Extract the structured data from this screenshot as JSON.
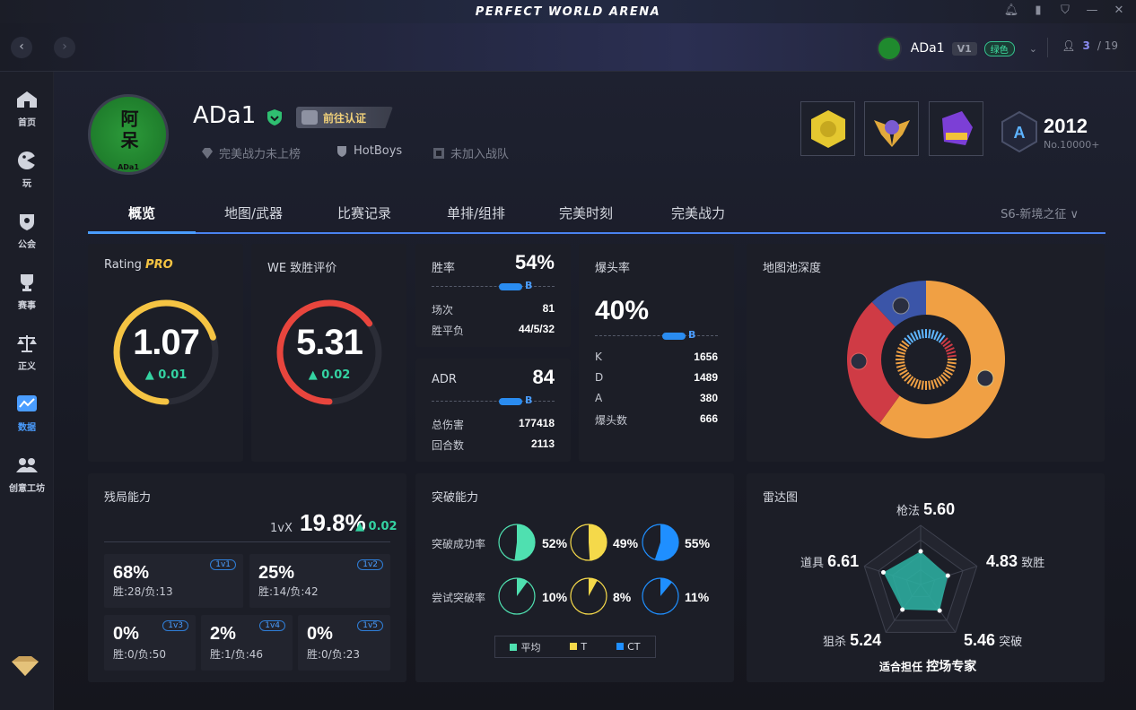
{
  "app": {
    "title": "PERFECT WORLD ARENA"
  },
  "window_controls": [
    "bell-icon",
    "signal-icon",
    "shield-icon",
    "minimize-icon",
    "close-icon"
  ],
  "topbar": {
    "username": "ADa1",
    "level": "V1",
    "trust_badge": "绿色",
    "online_current": "3",
    "online_total": "/ 19"
  },
  "sidebar": {
    "items": [
      {
        "label": "首页",
        "icon": "home-icon"
      },
      {
        "label": "玩",
        "icon": "play-icon"
      },
      {
        "label": "公会",
        "icon": "guild-icon"
      },
      {
        "label": "赛事",
        "icon": "trophy-icon"
      },
      {
        "label": "正义",
        "icon": "justice-scale-icon"
      },
      {
        "label": "数据",
        "icon": "data-chart-icon"
      },
      {
        "label": "创意工坊",
        "icon": "workshop-icon"
      }
    ]
  },
  "profile": {
    "name": "ADa1",
    "verify_label": "前往认证",
    "power_rank": "完美战力未上榜",
    "team": "HotBoys",
    "clan": "未加入战队",
    "avatar_text": "阿呆",
    "avatar_sub": "ADa1",
    "rank_letter": "A",
    "rank_score": "2012",
    "rank_no": "No.10000+"
  },
  "tabs": {
    "items": [
      "概览",
      "地图/武器",
      "比赛记录",
      "单排/组排",
      "完美时刻",
      "完美战力"
    ],
    "active": 0,
    "season": "S6-新境之征 ∨"
  },
  "rating": {
    "title": "Rating ",
    "pro": "PRO",
    "value": "1.07",
    "delta": "▲ 0.01",
    "fill": 0.7,
    "color": "#f5c443"
  },
  "we": {
    "title": "WE 致胜评价",
    "value": "5.31",
    "delta": "▲ 0.02",
    "fill": 0.65,
    "color": "#e8453d"
  },
  "winrate": {
    "title": "胜率",
    "value": "54%",
    "grade": "B",
    "rows": [
      {
        "label": "场次",
        "value": "81"
      },
      {
        "label": "胜平负",
        "value": "44/5/32"
      }
    ]
  },
  "adr": {
    "title": "ADR",
    "value": "84",
    "grade": "B",
    "rows": [
      {
        "label": "总伤害",
        "value": "177418"
      },
      {
        "label": "回合数",
        "value": "2113"
      }
    ]
  },
  "headshot": {
    "title": "爆头率",
    "value": "40%",
    "grade": "B",
    "rows": [
      {
        "label": "K",
        "value": "1656"
      },
      {
        "label": "D",
        "value": "1489"
      },
      {
        "label": "A",
        "value": "380"
      },
      {
        "label": "爆头数",
        "value": "666"
      }
    ]
  },
  "map_pool": {
    "title": "地图池深度",
    "segments": [
      {
        "value": 0.6,
        "color": "#f0a044"
      },
      {
        "value": 0.28,
        "color": "#cf3b45"
      },
      {
        "value": 0.12,
        "color": "#3b55a8"
      }
    ]
  },
  "clutch": {
    "title": "残局能力",
    "label": "1vX",
    "value": "19.8%",
    "delta": "▲ 0.02",
    "boxes": [
      {
        "pct": "68%",
        "tag": "1v1",
        "record": "胜:28/负:13"
      },
      {
        "pct": "25%",
        "tag": "1v2",
        "record": "胜:14/负:42"
      },
      {
        "pct": "0%",
        "tag": "1v3",
        "record": "胜:0/负:50"
      },
      {
        "pct": "2%",
        "tag": "1v4",
        "record": "胜:1/负:46"
      },
      {
        "pct": "0%",
        "tag": "1v5",
        "record": "胜:0/负:23"
      }
    ]
  },
  "breakthrough": {
    "title": "突破能力",
    "rows": [
      {
        "label": "突破成功率",
        "values": [
          "52%",
          "49%",
          "55%"
        ],
        "fractions": [
          0.52,
          0.49,
          0.55
        ]
      },
      {
        "label": "尝试突破率",
        "values": [
          "10%",
          "8%",
          "11%"
        ],
        "fractions": [
          0.1,
          0.08,
          0.11
        ]
      }
    ],
    "legend": [
      {
        "label": "平均",
        "color": "#4fe0b0"
      },
      {
        "label": "T",
        "color": "#f5d94a"
      },
      {
        "label": "CT",
        "color": "#1f8fff"
      }
    ]
  },
  "radar": {
    "title": "雷达图",
    "axes": [
      {
        "name": "枪法",
        "value": "5.60"
      },
      {
        "name": "致胜",
        "value": "4.83"
      },
      {
        "name": "突破",
        "value": "5.46"
      },
      {
        "name": "狙杀",
        "value": "5.24"
      },
      {
        "name": "道具",
        "value": "6.61"
      }
    ],
    "role_prefix": "适合担任",
    "role": "控场专家",
    "fill_color": "#2bb3a3"
  }
}
